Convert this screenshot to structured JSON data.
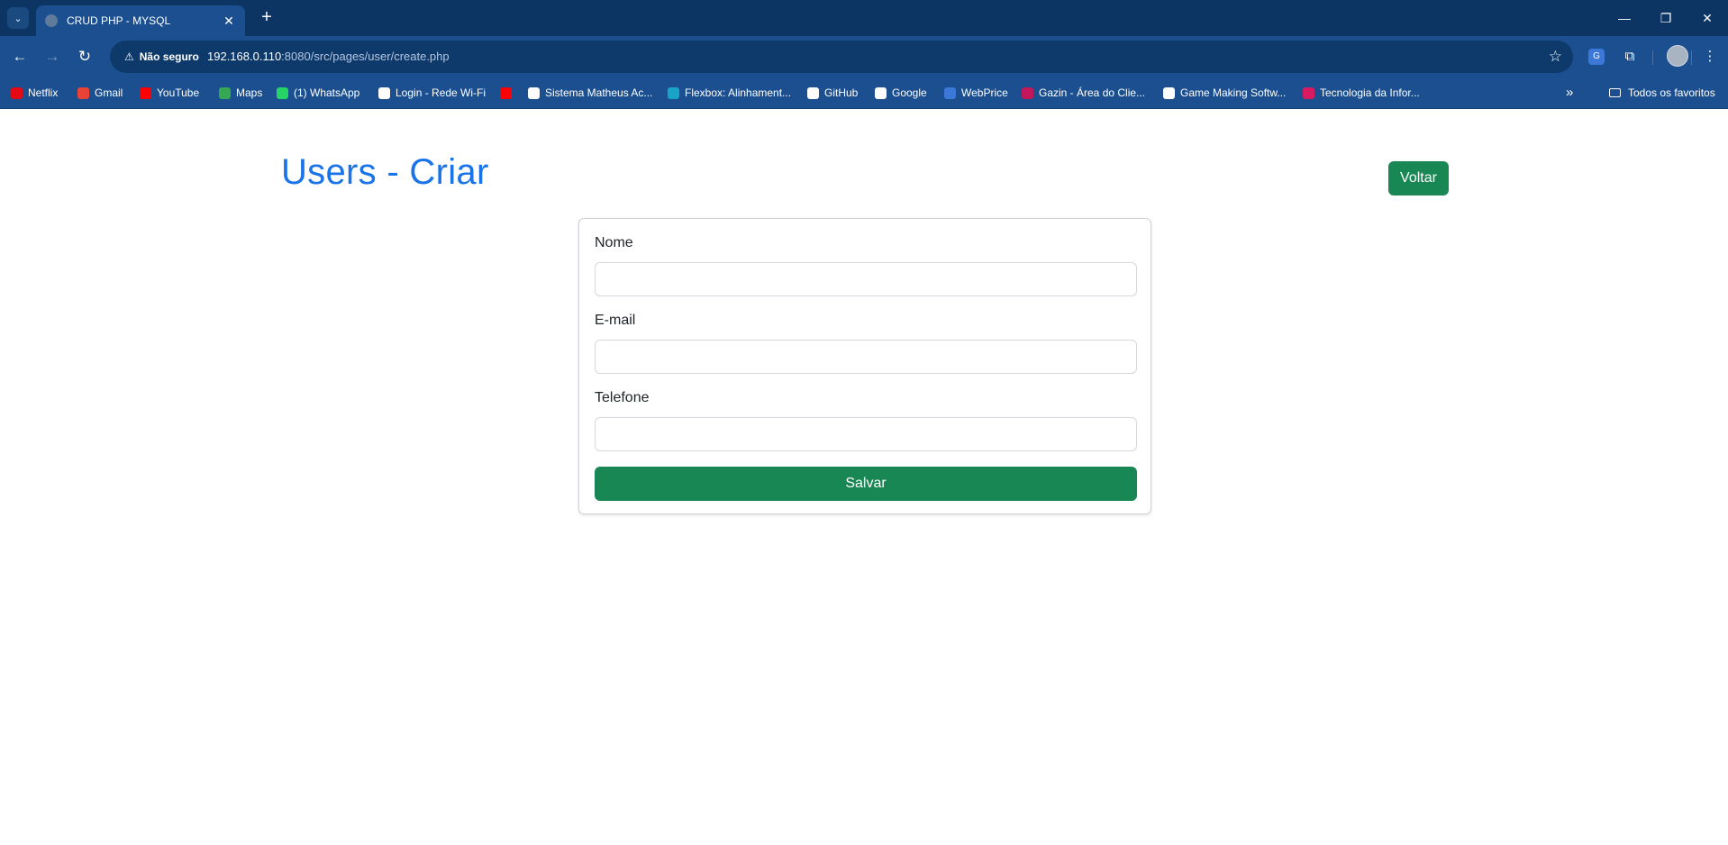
{
  "browser": {
    "tab_title": "CRUD PHP - MYSQL",
    "security_label": "Não seguro",
    "url_host": "192.168.0.110",
    "url_rest": ":8080/src/pages/user/create.php",
    "bookmarks": [
      {
        "label": "Netflix",
        "color": "#e50914",
        "icon": "netflix-icon"
      },
      {
        "label": "Gmail",
        "color": "#ea4335",
        "icon": "gmail-icon"
      },
      {
        "label": "YouTube",
        "color": "#ff0000",
        "icon": "youtube-icon"
      },
      {
        "label": "Maps",
        "color": "#34a853",
        "icon": "maps-icon"
      },
      {
        "label": "(1) WhatsApp",
        "color": "#25d366",
        "icon": "whatsapp-icon"
      },
      {
        "label": "Login - Rede Wi-Fi",
        "color": "#ffffff",
        "icon": "globe-icon"
      },
      {
        "label": "",
        "color": "#ff0000",
        "icon": "youtube-icon"
      },
      {
        "label": "Sistema Matheus Ac...",
        "color": "#ffffff",
        "icon": "page-icon"
      },
      {
        "label": "Flexbox: Alinhament...",
        "color": "#1aa3c8",
        "icon": "flexbox-icon"
      },
      {
        "label": "GitHub",
        "color": "#ffffff",
        "icon": "github-icon"
      },
      {
        "label": "Google",
        "color": "#ffffff",
        "icon": "google-icon"
      },
      {
        "label": "WebPrice",
        "color": "#3b78d8",
        "icon": "webprice-icon"
      },
      {
        "label": "Gazin - Área do Clie...",
        "color": "#c2185b",
        "icon": "gazin-icon"
      },
      {
        "label": "Game Making Softw...",
        "color": "#ffffff",
        "icon": "gamemaker-icon"
      },
      {
        "label": "Tecnologia da Infor...",
        "color": "#d81b60",
        "icon": "tech-icon"
      }
    ],
    "all_bookmarks_label": "Todos os favoritos"
  },
  "page": {
    "title": "Users - Criar",
    "back_button": "Voltar",
    "form": {
      "name_label": "Nome",
      "name_value": "",
      "email_label": "E-mail",
      "email_value": "",
      "phone_label": "Telefone",
      "phone_value": "",
      "submit_label": "Salvar"
    }
  },
  "colors": {
    "accent": "#1a73e8",
    "success": "#198754",
    "chrome_dark": "#0d3563",
    "chrome": "#1b4f8f"
  }
}
